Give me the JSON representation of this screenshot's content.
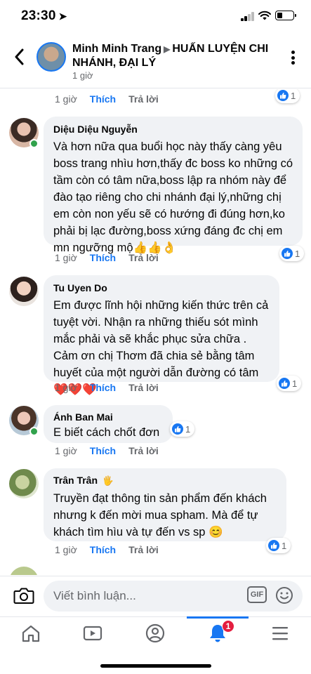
{
  "status_bar": {
    "time": "23:30",
    "location_arrow": "➤"
  },
  "header": {
    "author": "Minh Minh Trang",
    "separator": "▶",
    "group": "HUẤN LUYỆN CHI NHÁNH, ĐẠI LÝ",
    "time": "1 giờ"
  },
  "actions": {
    "like": "Thích",
    "reply": "Trả lời"
  },
  "comments": [
    {
      "time": "1 giờ",
      "reactions": "1"
    },
    {
      "author": "Diệu Diệu Nguyễn",
      "text": "Và hơn nữa qua buổi học này thấy càng yêu boss trang nhìu hơn,thấy đc boss ko những có tầm còn có tâm nữa,boss lập ra nhóm này để đào tạo riêng cho chi nhánh đại lý,những chị em còn non yếu sẽ có hướng đi đúng hơn,ko phải bị lạc đường,boss xứng đáng đc chị em mn ngưỡng mộ👍👍👌",
      "time": "1 giờ",
      "reactions": "1",
      "online": true
    },
    {
      "author": "Tu Uyen Do",
      "text": "Em được lĩnh hội những kiến thức trên cả tuyệt vời. Nhận ra những thiếu sót mình mắc phải và sẽ khắc phục sửa chữa . Cảm ơn chị Thơm đã chia sẻ bằng tâm huyết của một người dẫn đường có tâm ❤️❤️❤️",
      "time": "1 giờ",
      "reactions": "1",
      "online": false
    },
    {
      "author": "Ánh Ban Mai",
      "text": "E biết cách chốt đơn",
      "time": "1 giờ",
      "reactions": "1",
      "online": true
    },
    {
      "author": "Trân Trân",
      "author_badge": "🖐",
      "text": "Truyền đạt thông tin sản phẩm đến khách nhưng k đến mời mua spham. Mà để tự khách tìm hìu và tự đến vs sp 😊",
      "time": "1 giờ",
      "reactions": "1",
      "online": false
    }
  ],
  "composer": {
    "placeholder": "Viết bình luận...",
    "gif": "GIF"
  },
  "nav": {
    "notifications_badge": "1"
  },
  "icons": [
    "back-icon",
    "more-icon",
    "camera-icon",
    "gif-icon",
    "emoji-icon",
    "home-icon",
    "watch-icon",
    "profile-icon",
    "bell-icon",
    "menu-icon",
    "like-reaction-icon"
  ],
  "colors": {
    "accent": "#1877f2",
    "bubble": "#f0f2f5",
    "secondary_text": "#65676b",
    "online": "#31a24c",
    "badge": "#e41e3f"
  }
}
